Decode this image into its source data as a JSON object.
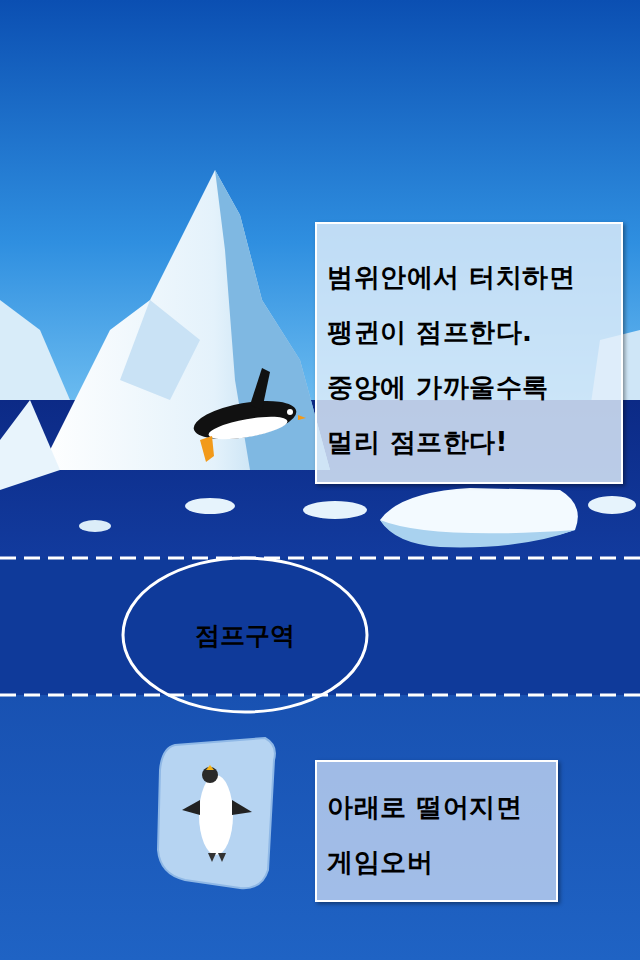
{
  "hint_box": {
    "lines": [
      "범위안에서 터치하면",
      "팽귄이 점프한다.",
      "중앙에 가까울수록",
      "멀리 점프한다!"
    ]
  },
  "jump_zone": {
    "label": "점프구역"
  },
  "gameover_box": {
    "lines": [
      "아래로 떨어지면",
      "게임오버"
    ]
  }
}
